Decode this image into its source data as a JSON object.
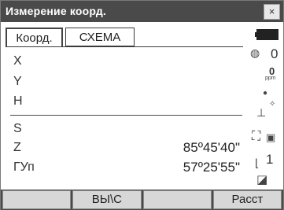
{
  "window": {
    "title": "Измерение коорд.",
    "close_label": "×"
  },
  "tabs": [
    {
      "label": "Коорд."
    },
    {
      "label": "СХЕМА"
    }
  ],
  "fields": [
    {
      "label": "X",
      "value": ""
    },
    {
      "label": "Y",
      "value": ""
    },
    {
      "label": "H",
      "value": ""
    },
    {
      "label": "S",
      "value": ""
    },
    {
      "label": "Z",
      "value": "85º45'40\""
    },
    {
      "label": "ГУп",
      "value": "57º25'55\""
    }
  ],
  "side_panel": {
    "prism_constant": "0",
    "ppm_value": "0",
    "ppm_unit": "ppm",
    "face_number": "1"
  },
  "softkeys": [
    {
      "label": ""
    },
    {
      "label": "ВЫ\\С"
    },
    {
      "label": ""
    },
    {
      "label": "Расст"
    }
  ],
  "colors": {
    "titlebar": "#4a4a4a",
    "softkey_bar": "#4a4a4a",
    "softkey": "#d7d7d7"
  }
}
